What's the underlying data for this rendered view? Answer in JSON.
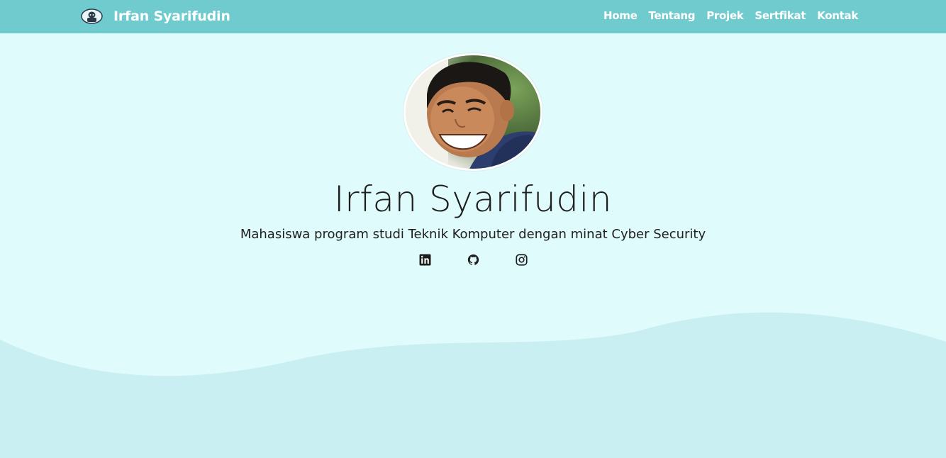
{
  "navbar": {
    "brand": "Irfan Syarifudin",
    "links": [
      "Home",
      "Tentang",
      "Projek",
      "Sertfikat",
      "Kontak"
    ]
  },
  "hero": {
    "name": "Irfan Syarifudin",
    "tagline": "Mahasiswa program studi Teknik Komputer dengan minat Cyber Security",
    "socials": [
      "linkedin-icon",
      "github-icon",
      "instagram-icon"
    ]
  },
  "colors": {
    "navbar_bg": "#70cbcf",
    "page_bg": "#e0fbfb",
    "wave": "#c9eff2",
    "text": "#1e1e1e"
  }
}
